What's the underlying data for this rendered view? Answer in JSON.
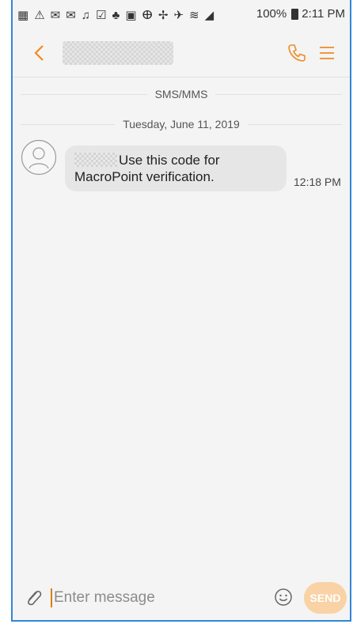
{
  "status_bar": {
    "battery": "100%",
    "time": "2:11 PM",
    "icons": [
      "more-icon",
      "warning-icon",
      "mail-icon",
      "mail-icon",
      "bell-icon",
      "checkbox-icon",
      "android-icon",
      "image-icon",
      "bluetooth-icon",
      "nfc-icon",
      "airplane-icon",
      "wifi-icon",
      "signal-icon",
      "battery-icon"
    ]
  },
  "app_bar": {
    "back_icon": "back-arrow-icon",
    "call_icon": "phone-icon",
    "menu_icon": "menu-icon",
    "accent": "#f08a24"
  },
  "conversation": {
    "channel_label": "SMS/MMS",
    "date_label": "Tuesday, June 11, 2019",
    "messages": [
      {
        "text": "Use this code for MacroPoint verification.",
        "time": "12:18 PM"
      }
    ]
  },
  "composer": {
    "placeholder": "Enter message",
    "send_label": "SEND",
    "attach_icon": "paperclip-icon",
    "emoji_icon": "smiley-icon"
  },
  "colors": {
    "frame_border": "#2f87d6",
    "background": "#f4f4f4",
    "bubble": "#e6e6e6",
    "send_button": "#f9d2a5"
  }
}
